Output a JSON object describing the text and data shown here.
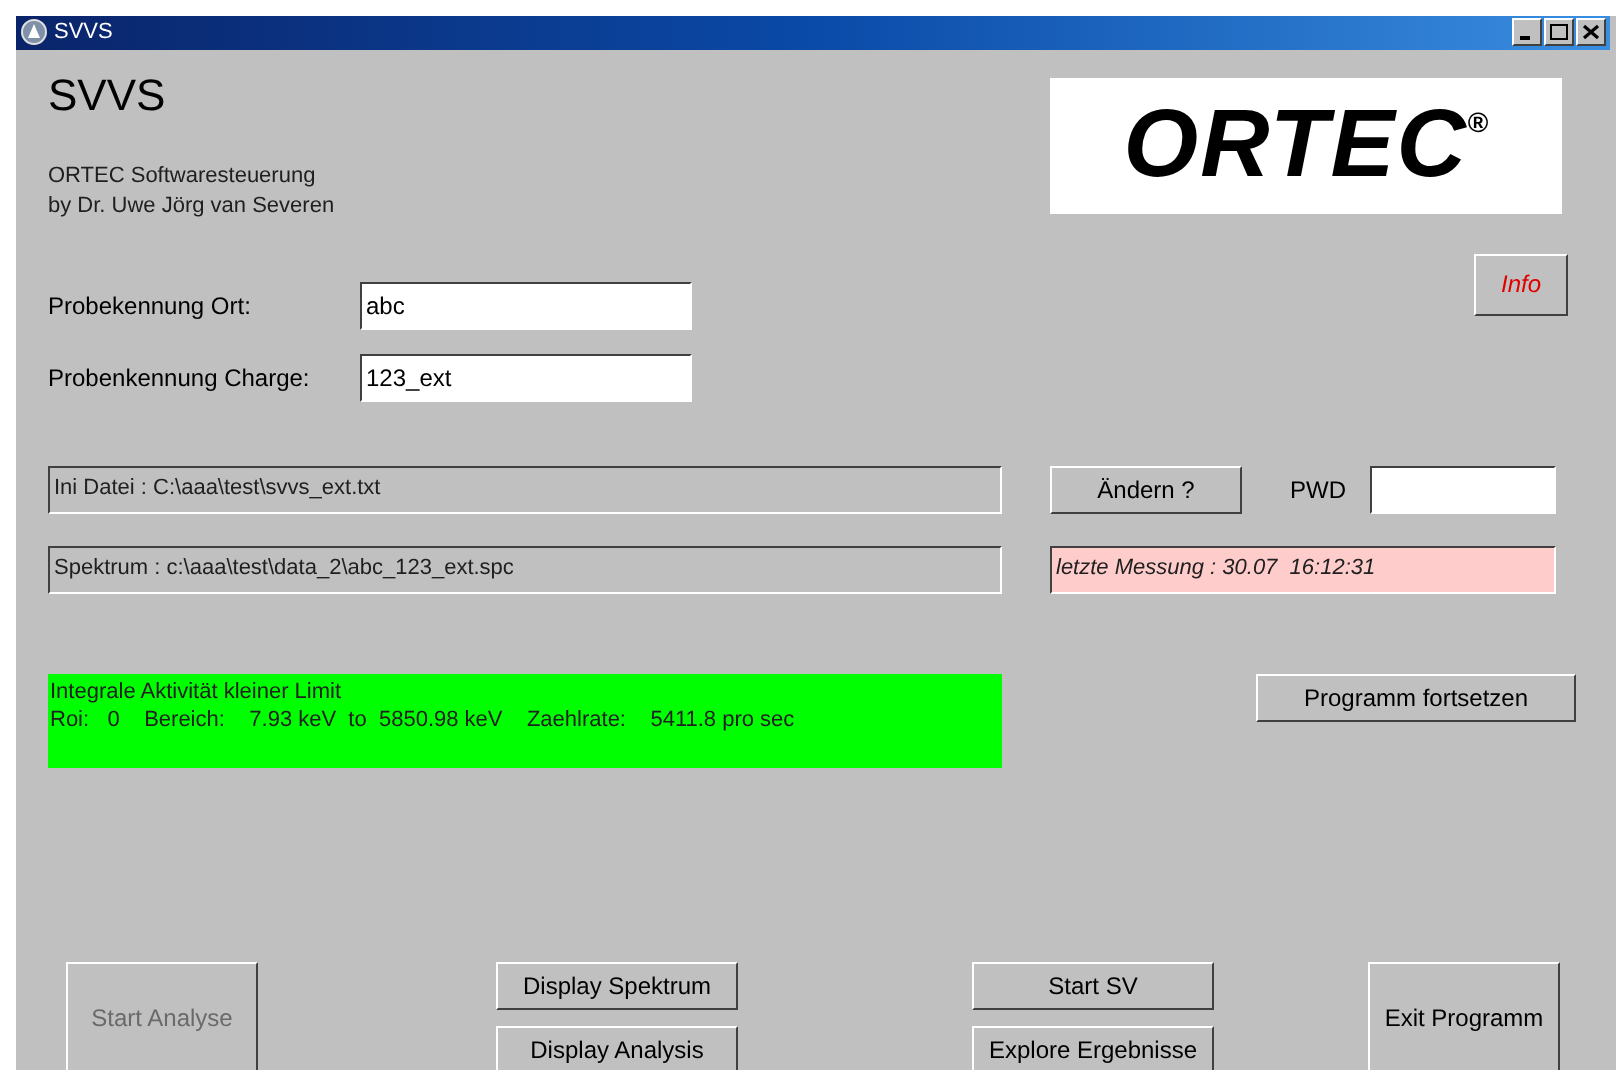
{
  "window": {
    "title": "SVVS"
  },
  "header": {
    "title": "SVVS",
    "subtitle": [
      "ORTEC Softwaresteuerung",
      "by Dr. Uwe Jörg van Severen"
    ],
    "logo": {
      "text": "ORTEC",
      "mark": "®"
    }
  },
  "info_button": "Info",
  "fields": [
    {
      "label": "Probekennung Ort:",
      "value": "abc"
    },
    {
      "label": "Probenkennung Charge:",
      "value": "123_ext"
    }
  ],
  "ini_file": "Ini Datei : C:\\aaa\\test\\svvs_ext.txt",
  "change_button": "Ändern ?",
  "pwd_label": "PWD",
  "spectrum": "Spektrum : c:\\aaa\\test\\data_2\\abc_123_ext.spc",
  "last_measurement": "letzte Messung : 30.07  16:12:31",
  "status_lines": [
    "Integrale Aktivität kleiner Limit",
    "Roi:   0    Bereich:    7.93 keV  to  5850.98 keV    Zaehlrate:    5411.8 pro sec"
  ],
  "continue_button": "Programm fortsetzen",
  "start_analysis": {
    "label": "Start Analyse",
    "disabled": true
  },
  "display_buttons": [
    {
      "label": "Display Spektrum",
      "disabled": false
    },
    {
      "label": "Display Analysis",
      "disabled": false
    }
  ],
  "sv_buttons": [
    {
      "label": "Start SV",
      "disabled": false
    },
    {
      "label": "Explore Ergebnisse",
      "disabled": false
    }
  ],
  "exit_button": {
    "label": "Exit Programm",
    "disabled": false
  }
}
